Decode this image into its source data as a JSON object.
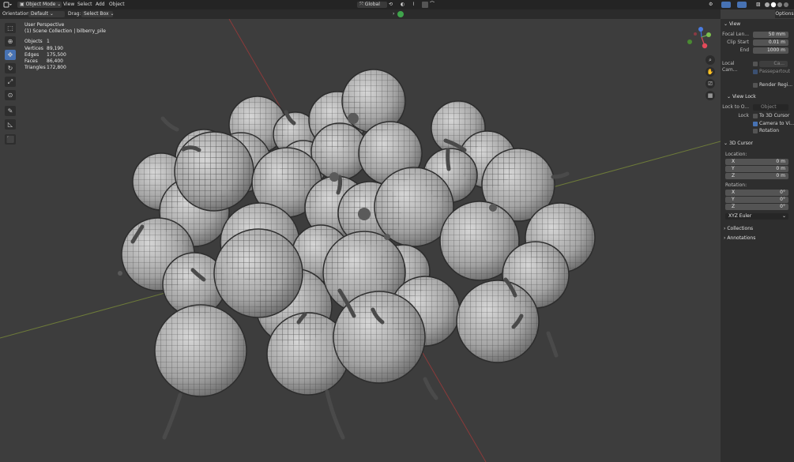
{
  "header": {
    "mode": "Object Mode",
    "menu": [
      "View",
      "Select",
      "Add",
      "Object"
    ],
    "transform_orientation": "Global"
  },
  "toolsettings": {
    "orientation_label": "Orientation:",
    "orientation_value": "Default",
    "drag_label": "Drag:",
    "drag_value": "Select Box",
    "options": "Options"
  },
  "viewport": {
    "view_name": "User Perspective",
    "collection_line": "(1) Scene Collection | bilberry_pile",
    "stats": [
      {
        "label": "Objects",
        "value": "1"
      },
      {
        "label": "Vertices",
        "value": "89,190"
      },
      {
        "label": "Edges",
        "value": "175,500"
      },
      {
        "label": "Faces",
        "value": "86,400"
      },
      {
        "label": "Triangles",
        "value": "172,800"
      }
    ],
    "gizmo": {
      "x": "X",
      "y": "Y",
      "z": "Z"
    }
  },
  "npanel": {
    "view_header": "View",
    "focal_length_label": "Focal Len...",
    "focal_length": "50 mm",
    "clip_start_label": "Clip Start",
    "clip_start": "0.01 m",
    "clip_end_label": "End",
    "clip_end": "1000 m",
    "local_camera_label": "Local Cam...",
    "local_camera_value": "Ca...",
    "passepartout": "Passepartout",
    "render_region": "Render Regi...",
    "view_lock_header": "View Lock",
    "lock_to_object_label": "Lock to O...",
    "lock_to_object_placeholder": "Object",
    "lock_label": "Lock",
    "to_3d_cursor": "To 3D Cursor",
    "camera_to_view": "Camera to Vi...",
    "rotation_lock": "Rotation",
    "cursor_header": "3D Cursor",
    "location_label": "Location:",
    "loc_x_label": "X",
    "loc_x": "0 m",
    "loc_y_label": "Y",
    "loc_y": "0 m",
    "loc_z_label": "Z",
    "loc_z": "0 m",
    "rotation_label": "Rotation:",
    "rot_x_label": "X",
    "rot_x": "0°",
    "rot_y_label": "Y",
    "rot_y": "0°",
    "rot_z_label": "Z",
    "rot_z": "0°",
    "rotation_mode": "XYZ Euler",
    "collections_header": "Collections",
    "annotations_header": "Annotations"
  }
}
